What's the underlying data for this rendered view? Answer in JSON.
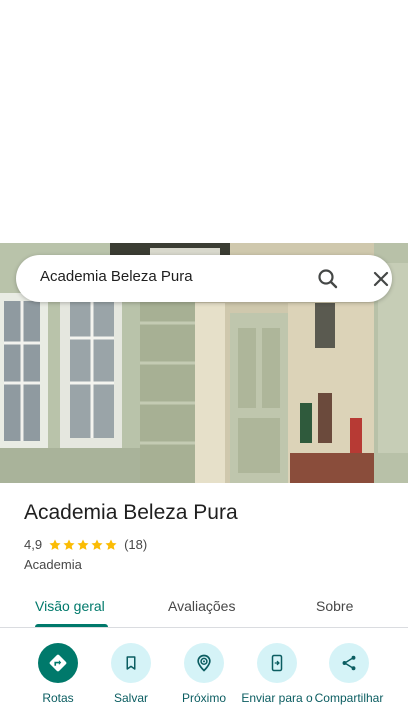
{
  "search": {
    "query": "Academia Beleza Pura"
  },
  "place": {
    "name": "Academia Beleza Pura",
    "rating": "4,9",
    "stars": 5,
    "review_count": "(18)",
    "category": "Academia"
  },
  "tabs": [
    {
      "label": "Visão geral",
      "active": true
    },
    {
      "label": "Avaliações",
      "active": false
    },
    {
      "label": "Sobre",
      "active": false
    }
  ],
  "actions": [
    {
      "label": "Rotas",
      "icon": "directions-icon"
    },
    {
      "label": "Salvar",
      "icon": "bookmark-icon"
    },
    {
      "label": "Próximo",
      "icon": "nearby-icon"
    },
    {
      "label": "Enviar para o",
      "icon": "send-to-phone-icon"
    },
    {
      "label": "Compartilhar",
      "icon": "share-icon"
    }
  ],
  "colors": {
    "accent": "#00796b",
    "action_bg": "#d5f3f7",
    "star": "#fbbc04"
  }
}
